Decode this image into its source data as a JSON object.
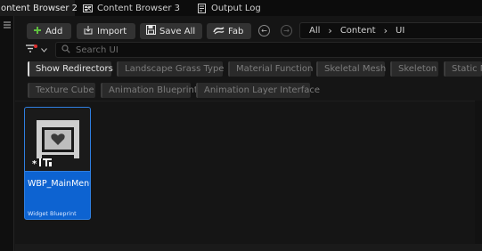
{
  "tabs": [
    {
      "label": "ontent Browser 2",
      "close": "×",
      "icon": "content-browser-icon",
      "active": true
    },
    {
      "label": "Content Browser 3",
      "icon": "content-browser-icon",
      "active": false
    },
    {
      "label": "Output Log",
      "icon": "output-log-icon",
      "active": false
    }
  ],
  "toolbar": {
    "add_label": "Add",
    "import_label": "Import",
    "save_all_label": "Save All",
    "fab_label": "Fab"
  },
  "breadcrumb": [
    "All",
    "Content",
    "UI"
  ],
  "search": {
    "placeholder": "Search UI"
  },
  "filters": {
    "row1": [
      "Show Redirectors",
      "Landscape Grass Type",
      "Material Function",
      "Skeletal Mesh",
      "Skeleton",
      "Static M"
    ],
    "row2": [
      "Texture Cube",
      "Animation Blueprint",
      "Animation Layer Interface"
    ]
  },
  "asset": {
    "name": "WBP_MainMenu",
    "type": "Widget Blueprint"
  },
  "colors": {
    "accent": "#0d63d1",
    "add_icon": "#5fbf3f"
  }
}
